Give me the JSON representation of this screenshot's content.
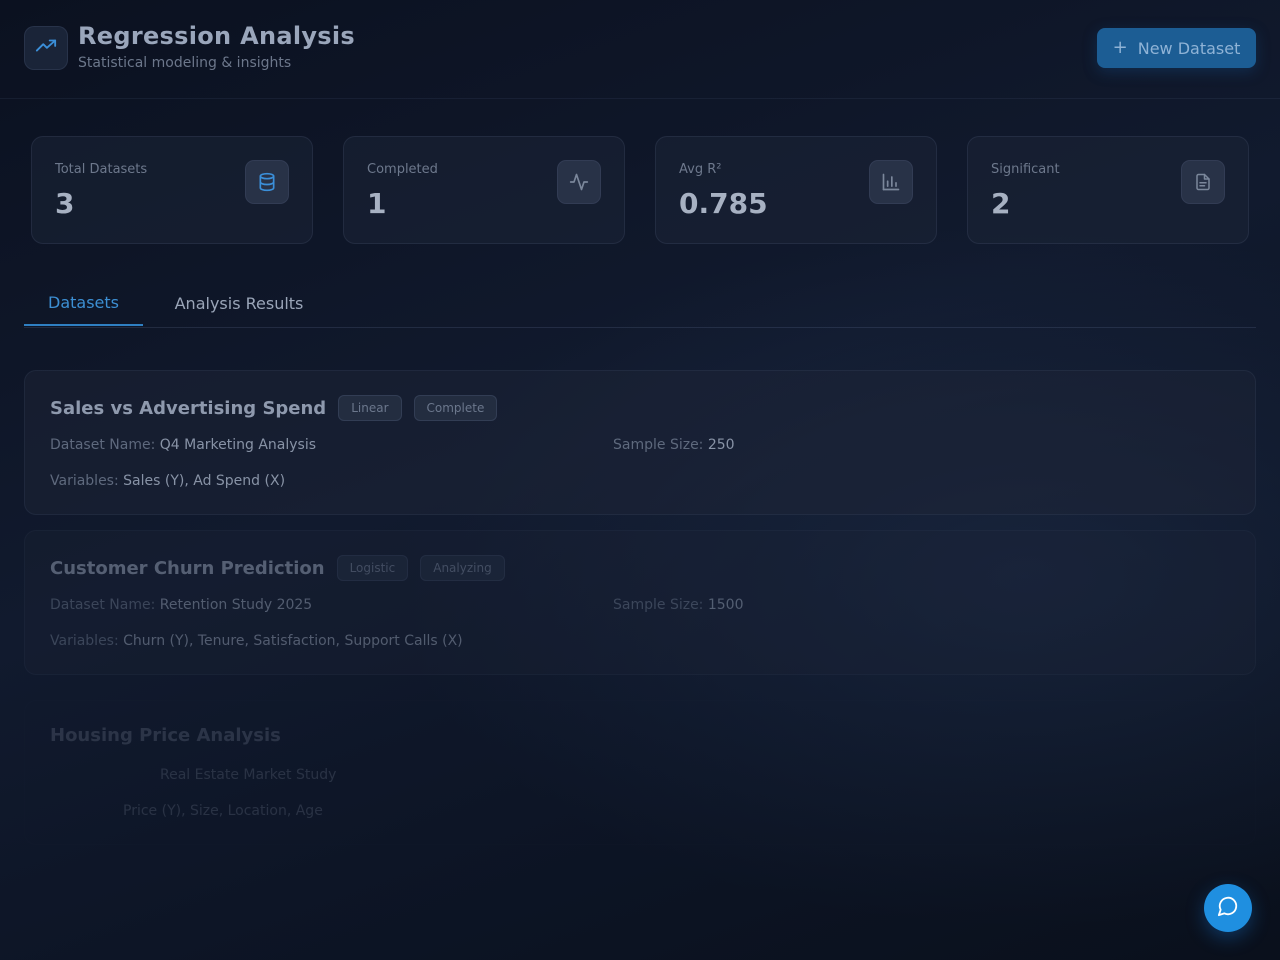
{
  "header": {
    "title": "Regression Analysis",
    "subtitle": "Statistical modeling & insights",
    "logo_icon": "trending-up-icon",
    "new_button": {
      "icon": "+",
      "label": "New Dataset"
    }
  },
  "stats": [
    {
      "label": "Total Datasets",
      "value": "3",
      "icon": "database-icon",
      "icon_color": "#3b8fd9"
    },
    {
      "label": "Completed",
      "value": "1",
      "icon": "activity-icon",
      "icon_color": "#7b879b"
    },
    {
      "label": "Avg R²",
      "value": "0.785",
      "icon": "bar-chart-icon",
      "icon_color": "#7b879b"
    },
    {
      "label": "Significant",
      "value": "2",
      "icon": "file-text-icon",
      "icon_color": "#7b879b"
    }
  ],
  "tabs": [
    {
      "label": "Datasets",
      "active": true
    },
    {
      "label": "Analysis Results",
      "active": false
    }
  ],
  "datasets": [
    {
      "title": "Sales vs Advertising Spend",
      "type": "Linear",
      "status": "Complete",
      "name_label": "Dataset Name:",
      "name": "Q4 Marketing Analysis",
      "size_label": "Sample Size:",
      "size": "250",
      "vars_label": "Variables:",
      "vars": "Sales (Y), Ad Spend (X)"
    },
    {
      "title": "Customer Churn Prediction",
      "type": "Logistic",
      "status": "Analyzing",
      "name_label": "Dataset Name:",
      "name": "Retention Study 2025",
      "size_label": "Sample Size:",
      "size": "1500",
      "vars_label": "Variables:",
      "vars": "Churn (Y), Tenure, Satisfaction, Support Calls (X)"
    },
    {
      "title": "Housing Price Analysis",
      "type": "",
      "status": "",
      "name_label": "",
      "name": "Real Estate Market Study",
      "size_label": "",
      "size": "",
      "vars_label": "",
      "vars": "Price (Y), Size, Location, Age"
    }
  ],
  "chat_button": {
    "icon": "chat-bubble-icon",
    "color": "#1f8fe0"
  },
  "colors": {
    "accent": "#2f7fc2",
    "background": "#0b1120",
    "card": "#1c2436"
  }
}
